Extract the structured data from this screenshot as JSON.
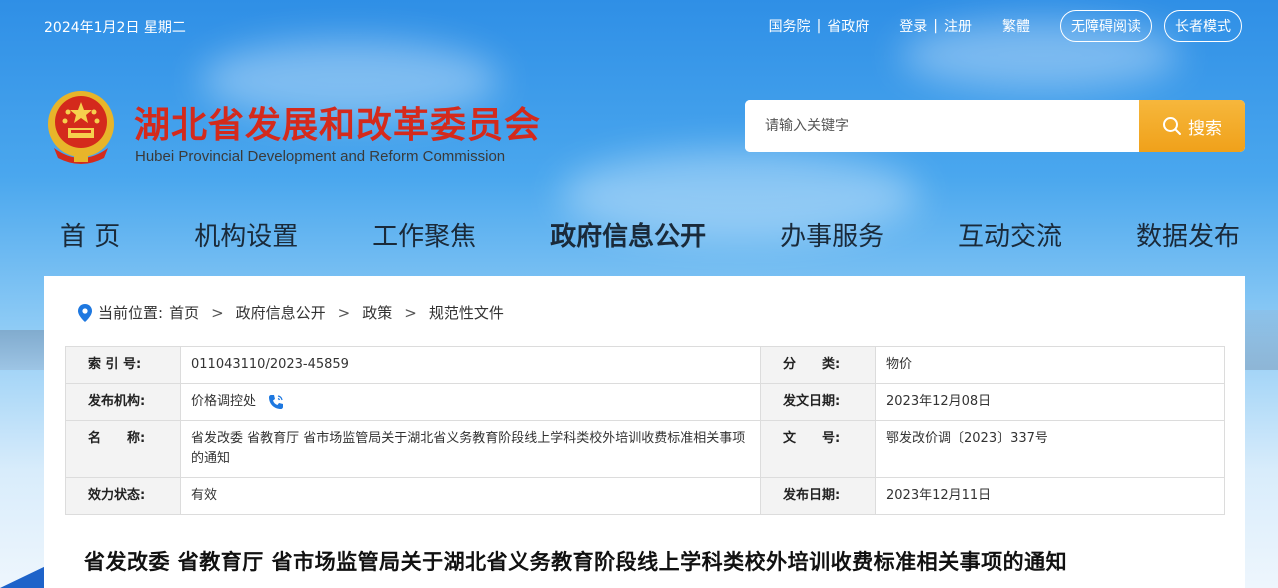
{
  "topbar": {
    "date": "2024年1月2日 星期二",
    "links": [
      "国务院",
      "省政府"
    ],
    "auth": [
      "登录",
      "注册"
    ],
    "traditional": "繁體",
    "accessibility": "无障碍阅读",
    "elder_mode": "长者模式"
  },
  "header": {
    "title": "湖北省发展和改革委员会",
    "subtitle": "Hubei Provincial Development and Reform Commission"
  },
  "search": {
    "placeholder": "请输入关键字",
    "button": "搜索"
  },
  "nav": {
    "items": [
      "首 页",
      "机构设置",
      "工作聚焦",
      "政府信息公开",
      "办事服务",
      "互动交流",
      "数据发布"
    ],
    "active_index": 3
  },
  "breadcrumb": {
    "prefix": "当前位置:",
    "items": [
      "首页",
      "政府信息公开",
      "政策",
      "规范性文件"
    ]
  },
  "meta": {
    "index_label": "索 引 号:",
    "index_value": "011043110/2023-45859",
    "category_label": "分　　类:",
    "category_value": "物价",
    "org_label": "发布机构:",
    "org_value": "价格调控处",
    "issue_date_label": "发文日期:",
    "issue_date_value": "2023年12月08日",
    "name_label": "名　　称:",
    "name_value": "省发改委 省教育厅 省市场监管局关于湖北省义务教育阶段线上学科类校外培训收费标准相关事项的通知",
    "docno_label": "文　　号:",
    "docno_value": "鄂发改价调〔2023〕337号",
    "status_label": "效力状态:",
    "status_value": "有效",
    "publish_date_label": "发布日期:",
    "publish_date_value": "2023年12月11日"
  },
  "document": {
    "title": "省发改委  省教育厅  省市场监管局关于湖北省义务教育阶段线上学科类校外培训收费标准相关事项的通知"
  },
  "colors": {
    "title_red": "#d42a1c",
    "search_orange": "#f0a11a",
    "sky_blue": "#2f8fe6"
  }
}
